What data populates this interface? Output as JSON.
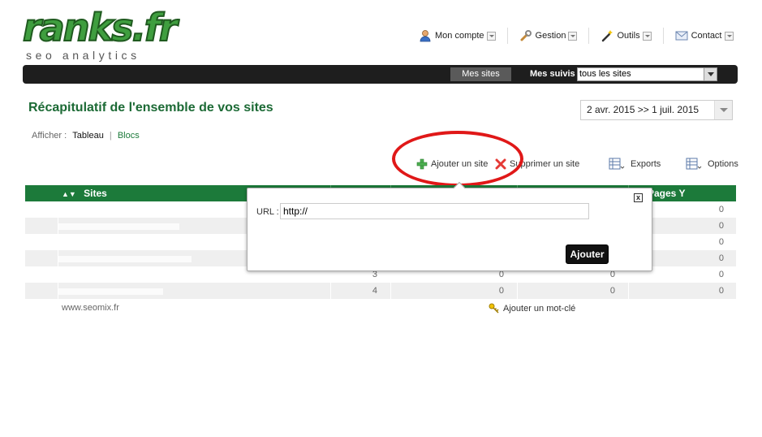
{
  "logo": {
    "main": "ranks.fr",
    "tagline": "seo analytics"
  },
  "top_menu": [
    {
      "label": "Mon compte",
      "icon": "user-icon"
    },
    {
      "label": "Gestion",
      "icon": "wrench-icon"
    },
    {
      "label": "Outils",
      "icon": "magic-wand-icon"
    },
    {
      "label": "Contact",
      "icon": "envelope-icon"
    }
  ],
  "navbar": {
    "mes_sites": "Mes sites",
    "mes_suivis_label": "Mes suivis",
    "mes_suivis_value": "tous les sites"
  },
  "page": {
    "title": "Récapitulatif de l'ensemble de vos sites",
    "date_range": "2 avr. 2015 >> 1 juil. 2015",
    "afficher_label": "Afficher :",
    "view_tableau": "Tableau",
    "view_blocs": "Blocs"
  },
  "actions": {
    "add_site": "Ajouter un site",
    "delete_site": "Supprimer un site",
    "exports": "Exports",
    "options": "Options"
  },
  "table": {
    "header_sites": "Sites",
    "header_last": "Pages Y",
    "rows": [
      {
        "c1": "",
        "c2": "",
        "c3": "",
        "c4": "0"
      },
      {
        "c1": "",
        "c2": "",
        "c3": "",
        "c4": "0"
      },
      {
        "c1": "",
        "c2": "",
        "c3": "",
        "c4": "0"
      },
      {
        "c1": "",
        "c2": "",
        "c3": "",
        "c4": "0"
      },
      {
        "c1": "3",
        "c2": "0",
        "c3": "0",
        "c4": "0"
      },
      {
        "c1": "4",
        "c2": "0",
        "c3": "0",
        "c4": "0"
      }
    ]
  },
  "footer": {
    "seomix": "www.seomix.fr",
    "add_keyword": "Ajouter un mot-clé"
  },
  "popup": {
    "url_label": "URL :",
    "url_value": "http://",
    "submit_label": "Ajouter",
    "close_label": "x"
  },
  "colors": {
    "brand_green": "#1c7a3a",
    "highlight_red": "#e01818",
    "navbar_black": "#1e1e1e"
  }
}
